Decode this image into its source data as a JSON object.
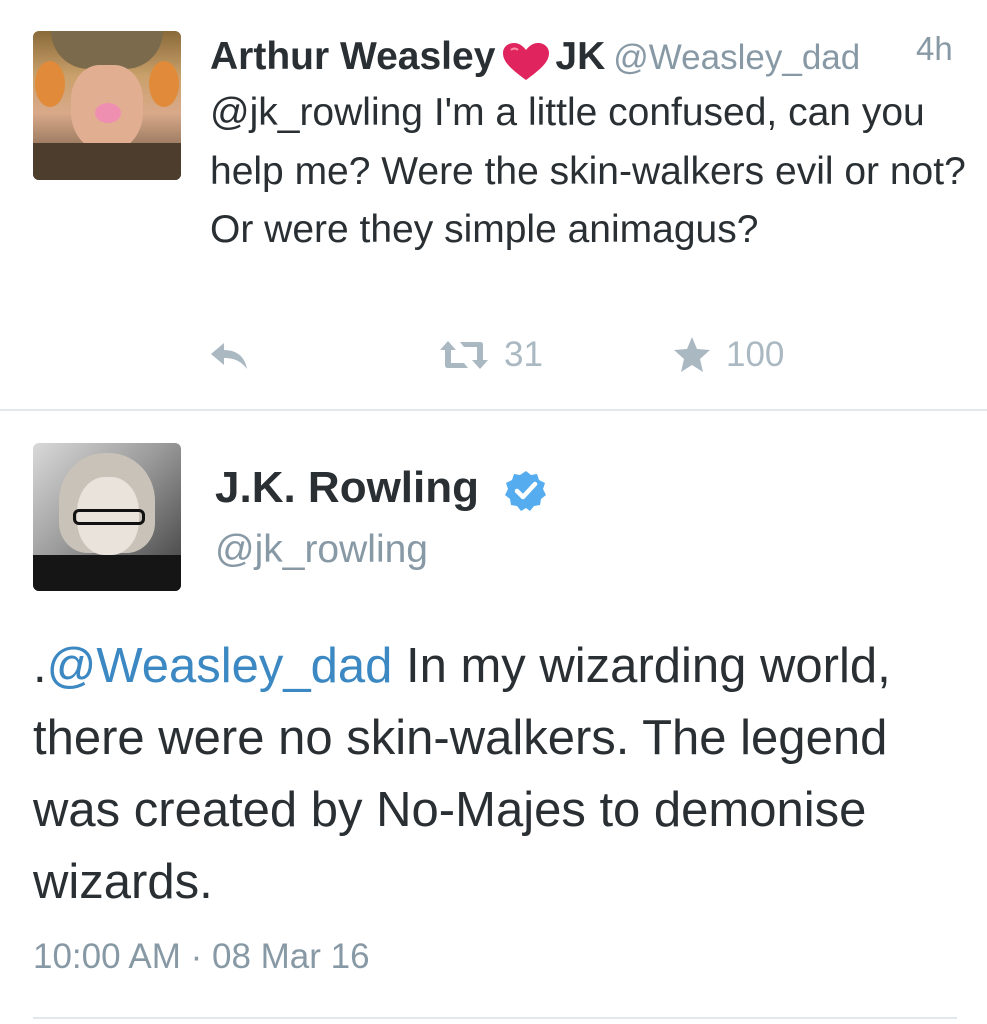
{
  "tweet1": {
    "name": "Arthur Weasley",
    "name_suffix": "JK",
    "handle": "@Weasley_dad",
    "time": "4h",
    "text": "@jk_rowling I'm a little confused, can you help me? Were the skin-walkers evil or not? Or were they simple animagus?",
    "retweets": "31",
    "favorites": "100",
    "icons": [
      "reply-icon",
      "retweet-icon",
      "star-icon",
      "heart-icon"
    ]
  },
  "tweet2": {
    "name": "J.K. Rowling",
    "handle": "@jk_rowling",
    "text_prefix": ".",
    "mention": "@Weasley_dad",
    "text_body": " In my wizarding world, there were no skin-walkers. The legend was created by No-Majes to demonise wizards.",
    "timestamp": "10:00 AM · 08 Mar 16",
    "icons": [
      "verified-icon"
    ]
  },
  "colors": {
    "text": "#292f33",
    "secondary": "#8899a6",
    "action": "#aab8c2",
    "link": "#3b88c3",
    "heart": "#e0245e",
    "verified": "#55acee",
    "divider": "#e1e8ed"
  }
}
